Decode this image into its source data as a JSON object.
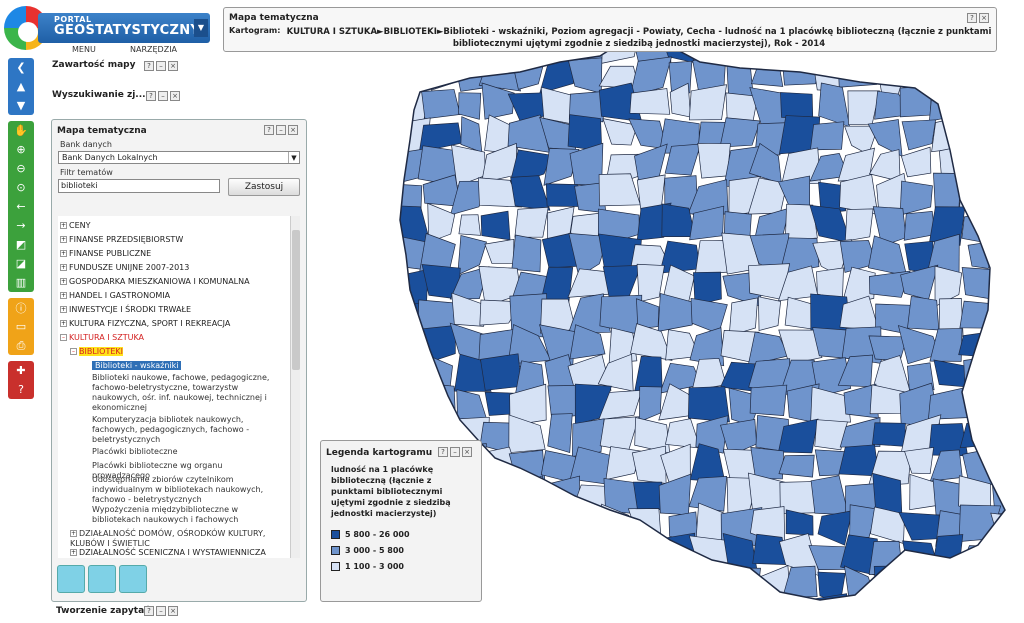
{
  "header": {
    "logo_top": "PORTAL",
    "logo_main": "GEOSTATYSTYCZNY",
    "menu": [
      "MENU",
      "NARZĘDZIA"
    ]
  },
  "panels": {
    "contents": "Zawartość mapy",
    "search": "Wyszukiwanie zj...",
    "query": "Tworzenie zapytań"
  },
  "thematic": {
    "title": "Mapa tematyczna",
    "bank_label": "Bank danych",
    "bank_value": "Bank Danych Lokalnych",
    "filter_label": "Filtr tematów",
    "filter_value": "biblioteki",
    "apply_label": "Zastosuj",
    "tree": [
      "CENY",
      "FINANSE PRZEDSIĘBIORSTW",
      "FINANSE PUBLICZNE",
      "FUNDUSZE UNIJNE 2007-2013",
      "GOSPODARKA MIESZKANIOWA I KOMUNALNA",
      "HANDEL I GASTRONOMIA",
      "INWESTYCJE I ŚRODKI TRWAŁE",
      "KULTURA FIZYCZNA, SPORT I REKREACJA",
      "KULTURA I SZTUKA",
      "BIBLIOTEKI",
      "Biblioteki - wskaźniki",
      "Biblioteki naukowe, fachowe, pedagogiczne, fachowo-beletrystyczne, towarzystw naukowych, ośr. inf. naukowej, technicznej i ekonomicznej",
      "Komputeryzacja bibliotek naukowych, fachowych, pedagogicznych, fachowo - beletrystycznych",
      "Placówki biblioteczne",
      "Placówki biblioteczne wg organu prowadzącego",
      "Udostępnianie zbiorów czytelnikom indywidualnym w bibliotekach naukowych, fachowo - beletrystycznych",
      "Wypożyczenia międzybiblioteczne w bibliotekach naukowych i fachowych",
      "DZIAŁALNOŚĆ DOMÓW, OŚRODKÓW KULTURY, KLUBÓW I ŚWIETLIC",
      "DZIAŁALNOŚĆ SCENICZNA I WYSTAWIENNICZA"
    ]
  },
  "map_title": {
    "title": "Mapa tematyczna",
    "kartogram_label": "Kartogram:",
    "text": "KULTURA I SZTUKA►BIBLIOTEKI►Biblioteki - wskaźniki, Poziom agregacji - Powiaty, Cecha - ludność na 1 placówkę biblioteczną (łącznie z punktami bibliotecznymi ujętymi zgodnie z siedzibą jednostki macierzystej), Rok - 2014"
  },
  "legend": {
    "title": "Legenda kartogramu",
    "description": "ludność na 1 placówkę biblioteczną (łącznie z punktami bibliotecznymi ujętymi zgodnie z siedzibą jednostki macierzystej)",
    "classes": [
      {
        "label": "5 800 - 26 000",
        "color": "#1a4f9c"
      },
      {
        "label": "3 000 - 5 800",
        "color": "#6f94cc"
      },
      {
        "label": "1 100 - 3 000",
        "color": "#d6e2f5"
      }
    ]
  },
  "colors": {
    "dark": "#1a4f9c",
    "mid": "#6f94cc",
    "light": "#d6e2f5",
    "border": "#1f2a44"
  }
}
